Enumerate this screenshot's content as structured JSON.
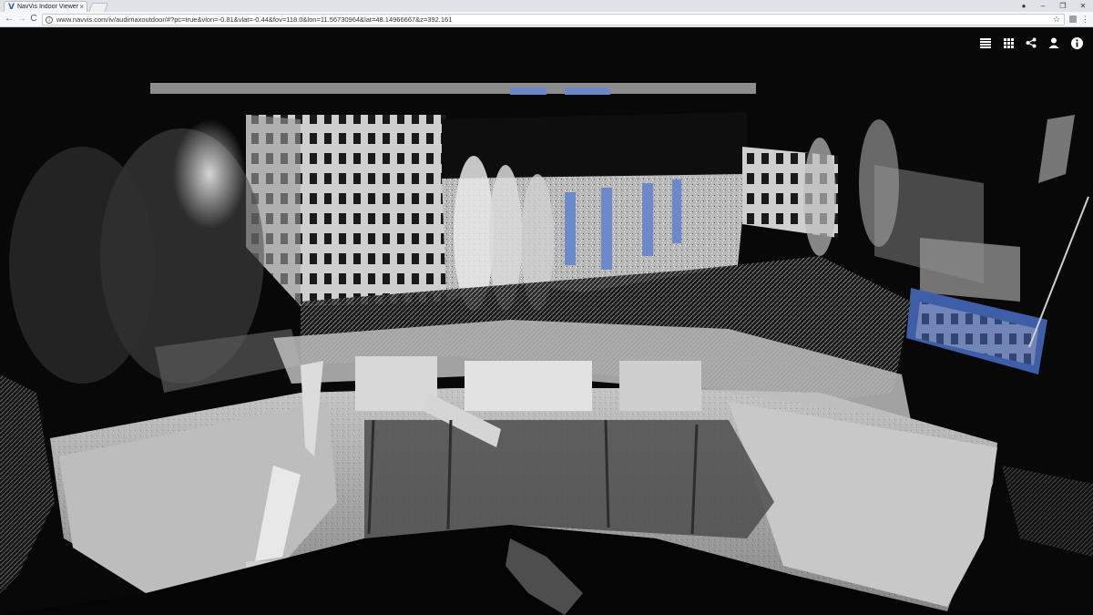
{
  "browser": {
    "tab_title": "NavVis Indoor Viewer",
    "tab_logo": "V",
    "tab_close": "×",
    "url": "www.navvis.com/iv/audimaxoutdoor/#?pc=true&vlon=-0.81&vlat=-0.44&fov=118.0&lon=11.56730964&lat=48.14966667&z=392.161",
    "back_icon": "←",
    "forward_icon": "→",
    "reload_icon": "C",
    "star_icon": "☆",
    "menu_icon": "⋮",
    "window_minimize": "–",
    "window_maximize": "❐",
    "window_close": "✕",
    "profile_icon": "●"
  },
  "viewer": {
    "toolbar_icons": [
      "list-icon",
      "grid-icon",
      "share-icon",
      "user-icon",
      "info-icon"
    ],
    "background_color": "#080808",
    "icon_color": "#ffffff"
  }
}
